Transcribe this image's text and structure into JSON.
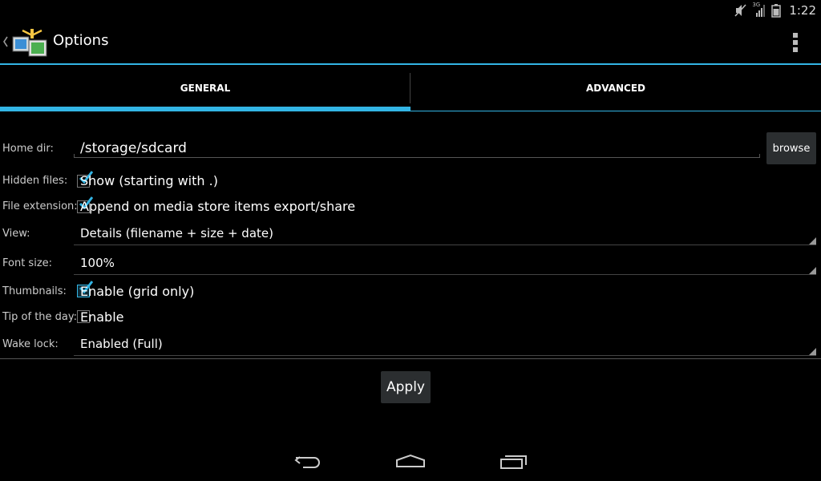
{
  "status_bar": {
    "time": "1:22",
    "network_label": "3G",
    "icons": [
      "mute-icon",
      "signal-3g-icon",
      "battery-icon"
    ]
  },
  "action_bar": {
    "title": "Options",
    "app_icon": "file-manager-icon",
    "overflow_icon": "overflow-menu-icon"
  },
  "tabs": [
    {
      "label": "GENERAL",
      "active": true
    },
    {
      "label": "ADVANCED",
      "active": false
    }
  ],
  "form": {
    "home_dir": {
      "label": "Home dir:",
      "value": "/storage/sdcard",
      "browse_label": "browse"
    },
    "hidden_files": {
      "label": "Hidden files:",
      "option": "Show (starting with .)",
      "checked": true
    },
    "file_extension": {
      "label": "File extension:",
      "option": "Append on media store items export/share",
      "checked": true
    },
    "view": {
      "label": "View:",
      "selected": "Details (filename + size + date)"
    },
    "font_size": {
      "label": "Font size:",
      "selected": "100%"
    },
    "thumbnails": {
      "label": "Thumbnails:",
      "option": "Enable (grid only)",
      "checked": true
    },
    "tip_of_day": {
      "label": "Tip of the day:",
      "option": "Enable",
      "checked": false
    },
    "wake_lock": {
      "label": "Wake lock:",
      "selected": "Enabled (Full)"
    }
  },
  "apply_label": "Apply",
  "colors": {
    "accent": "#33b5e5",
    "background": "#000000",
    "button": "#2b2e30"
  },
  "nav_bar": {
    "icons": [
      "back-icon",
      "home-icon",
      "recents-icon"
    ]
  }
}
